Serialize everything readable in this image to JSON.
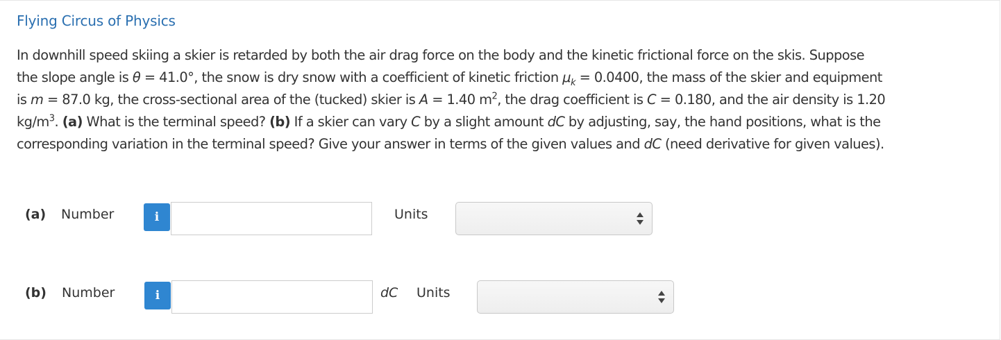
{
  "header": {
    "title": "Flying Circus of Physics"
  },
  "question": {
    "l1_a": "In downhill speed skiing a skier is retarded by both the air drag force on the body and the kinetic frictional force on the skis. Suppose",
    "l2_a": "the slope angle is ",
    "l2_theta": "θ",
    "l2_b": " = 41.0°, the snow is dry snow with a coefficient of kinetic friction ",
    "l2_mu": "μ",
    "l2_k": "k",
    "l2_c": " = 0.0400, the mass of the skier and equipment",
    "l3_a": "is ",
    "l3_m": "m",
    "l3_b": " = 87.0 kg, the cross-sectional area of the (tucked) skier is ",
    "l3_A": "A",
    "l3_c": " = 1.40 m",
    "l3_sup2": "2",
    "l3_d": ", the drag coefficient is ",
    "l3_C": "C",
    "l3_e": " = 0.180, and the air density is 1.20",
    "l4_a": "kg/m",
    "l4_sup3": "3",
    "l4_b": ". ",
    "l4_parta": "(a)",
    "l4_c": " What is the terminal speed? ",
    "l4_partb": "(b)",
    "l4_d": " If a skier can vary ",
    "l4_C": "C",
    "l4_e": " by a slight amount ",
    "l4_dC": "dC",
    "l4_f": " by adjusting, say, the hand positions, what is the",
    "l5_a": "corresponding variation in the terminal speed? Give your answer in terms of the given values and ",
    "l5_dC": "dC",
    "l5_b": " (need derivative for given values)."
  },
  "answers": {
    "a": {
      "part_label": "(a)",
      "number_label": "Number",
      "info_icon": "i",
      "value": "",
      "units_label": "Units",
      "units_selected": ""
    },
    "b": {
      "part_label": "(b)",
      "number_label": "Number",
      "info_icon": "i",
      "value": "",
      "dc_label": "dC",
      "units_label": "Units",
      "units_selected": ""
    }
  },
  "colors": {
    "title": "#2a6fb0",
    "info_button": "#2f86d1",
    "text": "#333333"
  }
}
